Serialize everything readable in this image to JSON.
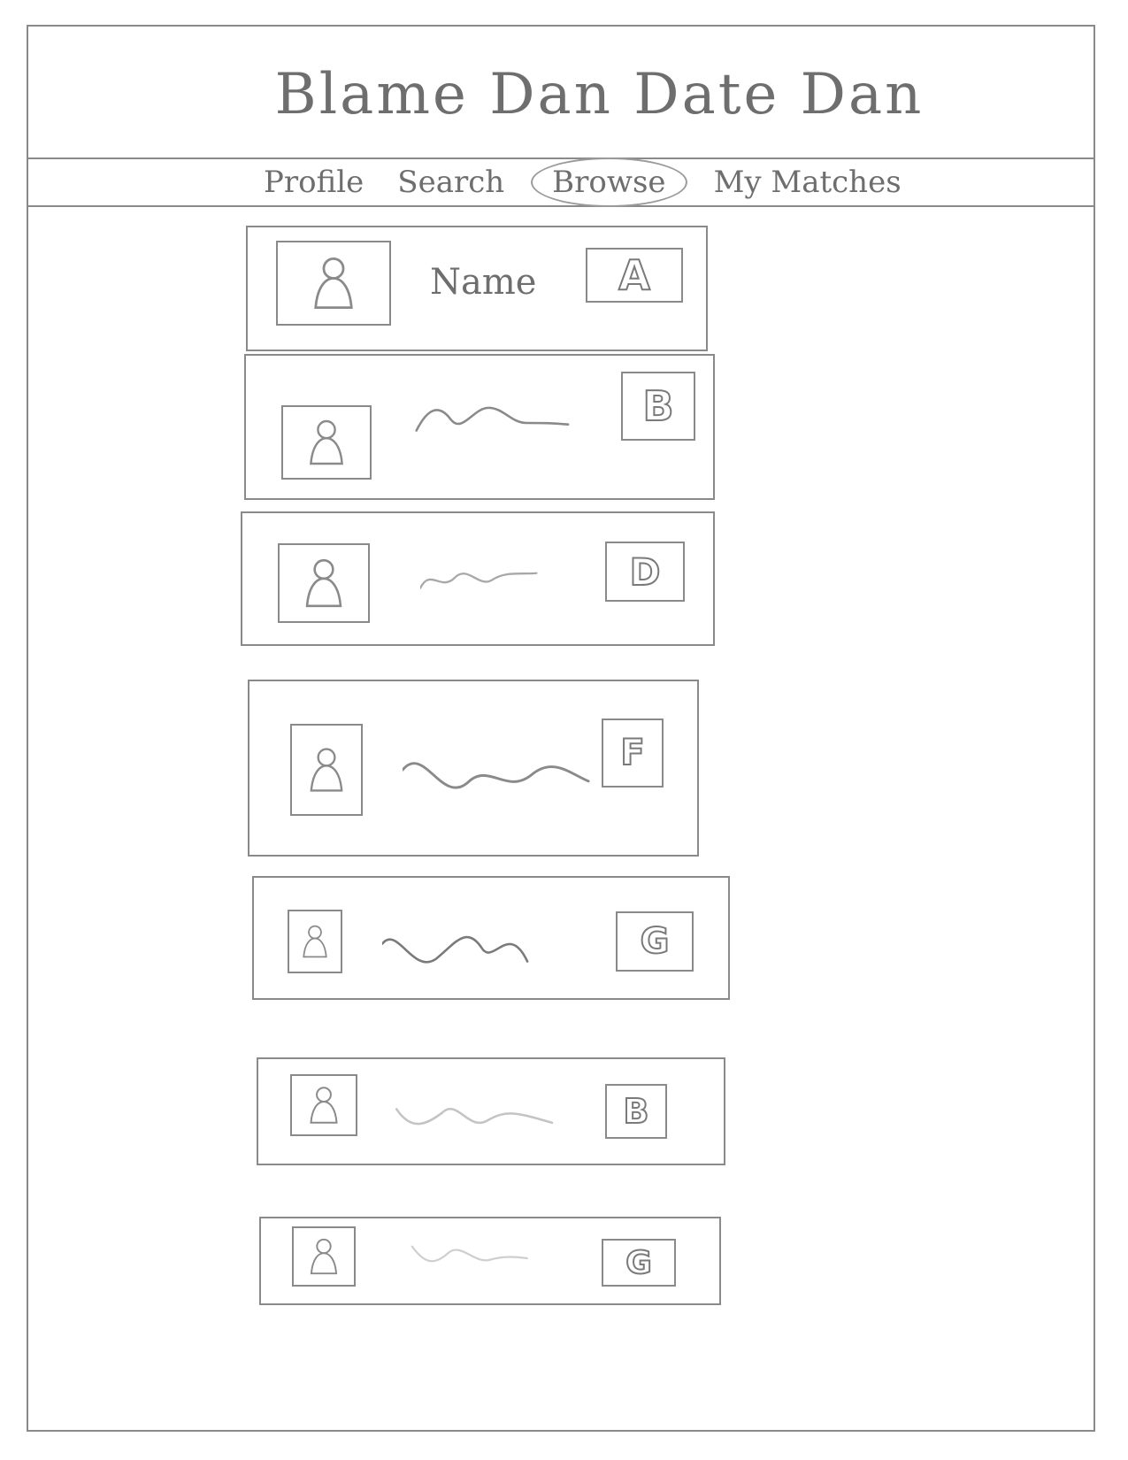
{
  "app": {
    "title": "Blame Dan   Date Dan"
  },
  "nav": {
    "items": [
      {
        "label": "Profile",
        "active": false
      },
      {
        "label": "Search",
        "active": false
      },
      {
        "label": "Browse",
        "active": true
      },
      {
        "label": "My Matches",
        "active": false
      }
    ]
  },
  "profiles": [
    {
      "name": "Name",
      "name_shown": true,
      "grade": "A",
      "avatar_icon": "person-icon",
      "squiggle_shade": "#8a8a8a"
    },
    {
      "name": "",
      "name_shown": false,
      "grade": "B",
      "avatar_icon": "person-icon",
      "squiggle_shade": "#8a8a8a"
    },
    {
      "name": "",
      "name_shown": false,
      "grade": "D",
      "avatar_icon": "person-icon",
      "squiggle_shade": "#a8a8a8"
    },
    {
      "name": "",
      "name_shown": false,
      "grade": "F",
      "avatar_icon": "person-icon",
      "squiggle_shade": "#8a8a8a"
    },
    {
      "name": "",
      "name_shown": false,
      "grade": "G",
      "avatar_icon": "person-icon",
      "squiggle_shade": "#7a7a7a"
    },
    {
      "name": "",
      "name_shown": false,
      "grade": "B",
      "avatar_icon": "person-icon",
      "squiggle_shade": "#c4c4c4"
    },
    {
      "name": "",
      "name_shown": false,
      "grade": "G",
      "avatar_icon": "person-icon",
      "squiggle_shade": "#cfcfcf"
    }
  ],
  "colors": {
    "ink": "#8a8a8a",
    "background": "#ffffff"
  }
}
